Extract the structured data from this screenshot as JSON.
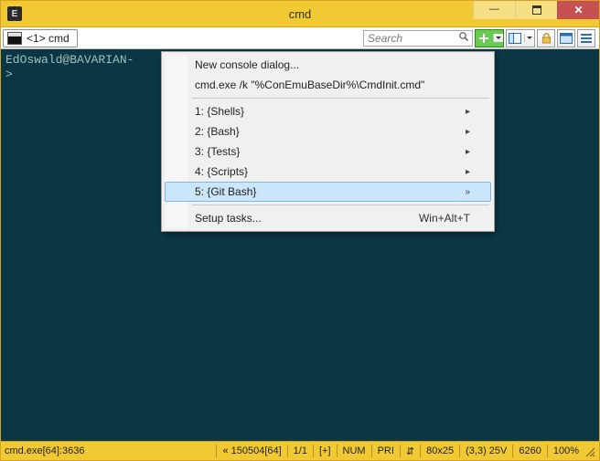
{
  "window": {
    "title": "cmd",
    "app_icon_glyph": "E"
  },
  "tabs": [
    {
      "label": "<1> cmd"
    }
  ],
  "search": {
    "placeholder": "Search"
  },
  "terminal": {
    "lines": [
      "EdOswald@BAVARIAN-",
      ">"
    ]
  },
  "menu": {
    "items": [
      {
        "type": "item",
        "label": "New console dialog...",
        "submenu": false
      },
      {
        "type": "item",
        "label": "cmd.exe /k \"%ConEmuBaseDir%\\CmdInit.cmd\"",
        "submenu": false
      },
      {
        "type": "sep"
      },
      {
        "type": "item",
        "label": "1: {Shells}",
        "submenu": true
      },
      {
        "type": "item",
        "label": "2: {Bash}",
        "submenu": true
      },
      {
        "type": "item",
        "label": "3: {Tests}",
        "submenu": true
      },
      {
        "type": "item",
        "label": "4: {Scripts}",
        "submenu": true
      },
      {
        "type": "item",
        "label": "5: {Git Bash}",
        "submenu": true,
        "hover": true,
        "expand_glyph": "»"
      },
      {
        "type": "sep"
      },
      {
        "type": "item",
        "label": "Setup tasks...",
        "submenu": false,
        "shortcut": "Win+Alt+T"
      }
    ]
  },
  "statusbar": {
    "process": "cmd.exe[64]:3636",
    "build": "« 150504[64]",
    "tabs_count": "1/1",
    "caps": "[+]",
    "num": "NUM",
    "pri": "PRI",
    "arrows": "⇵",
    "size": "80x25",
    "cursor": "(3,3) 25V",
    "pid2": "6260",
    "zoom": "100%"
  }
}
